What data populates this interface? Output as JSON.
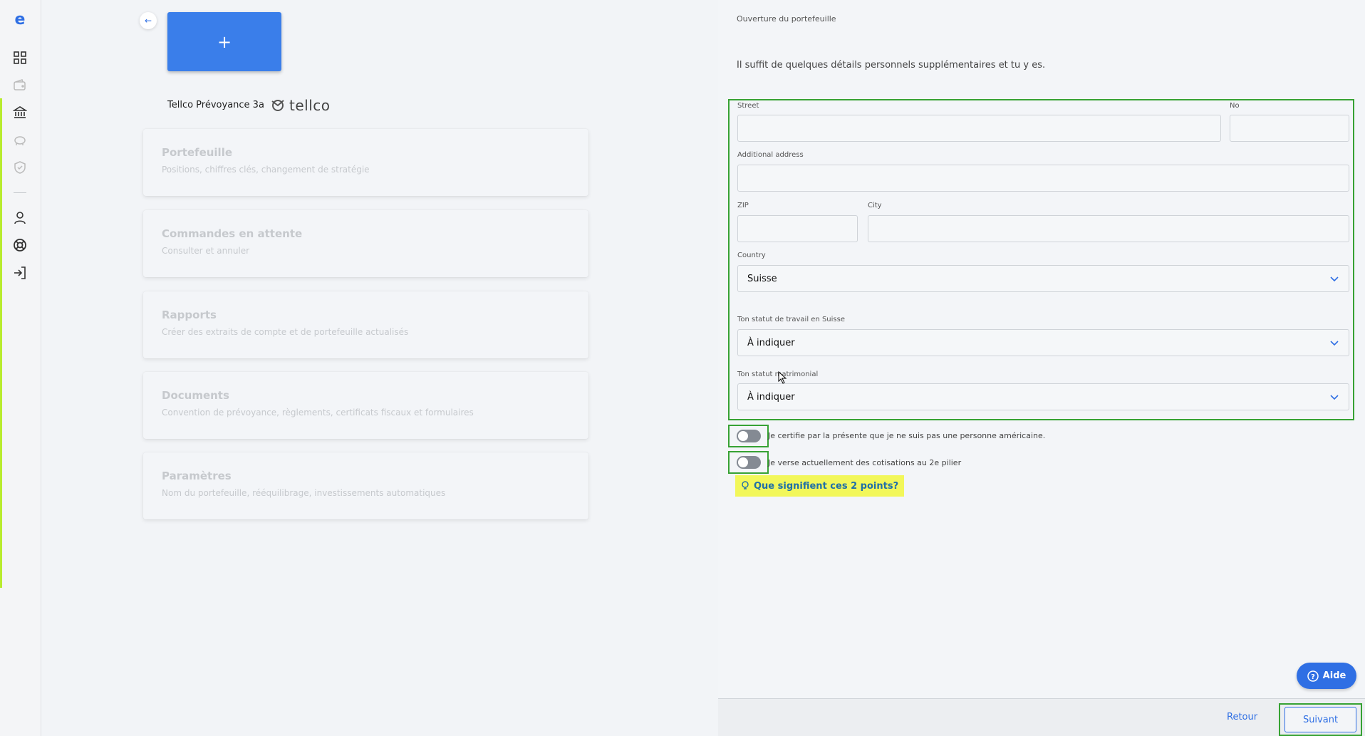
{
  "sidebar": {
    "logo": "e",
    "icons": [
      "dashboard-icon",
      "wallet-icon",
      "bank-icon",
      "piggy-bank-icon",
      "shield-icon",
      "user-icon",
      "lifebuoy-icon",
      "logout-icon"
    ]
  },
  "left": {
    "add_label": "+",
    "product_title": "Tellco Prévoyance 3a",
    "product_logo_text": "tellco",
    "cards": [
      {
        "title": "Portefeuille",
        "subtitle": "Positions, chiffres clés, changement de stratégie"
      },
      {
        "title": "Commandes en attente",
        "subtitle": "Consulter et annuler"
      },
      {
        "title": "Rapports",
        "subtitle": "Créer des extraits de compte et de portefeuille actualisés"
      },
      {
        "title": "Documents",
        "subtitle": "Convention de prévoyance, règlements, certificats fiscaux et formulaires"
      },
      {
        "title": "Paramètres",
        "subtitle": "Nom du portefeuille, rééquilibrage, investissements automatiques"
      }
    ]
  },
  "right": {
    "header": "Ouverture du portefeuille",
    "intro": "Il suffit de quelques détails personnels supplémentaires et tu y es.",
    "form": {
      "street_label": "Street",
      "street_value": "",
      "no_label": "No",
      "no_value": "",
      "additional_label": "Additional address",
      "additional_value": "",
      "zip_label": "ZIP",
      "zip_value": "",
      "city_label": "City",
      "city_value": "",
      "country_label": "Country",
      "country_value": "Suisse",
      "work_status_label": "Ton statut de travail en Suisse",
      "work_status_value": "À indiquer",
      "marital_label": "Ton statut matrimonial",
      "marital_value": "À indiquer"
    },
    "toggles": [
      {
        "label": "Je certifie par la présente que je ne suis pas une personne américaine.",
        "checked": false
      },
      {
        "label": "Je verse actuellement des cotisations au 2e pilier",
        "checked": false
      }
    ],
    "hint": "Que signifient ces 2 points?",
    "aide_label": "Aide",
    "footer": {
      "retour": "Retour",
      "suivant": "Suivant"
    }
  },
  "colors": {
    "accent": "#2f6fe4",
    "highlight": "#37a234",
    "sidebar_accent": "#b8ec2f",
    "hint_bg": "#f2f75a"
  }
}
